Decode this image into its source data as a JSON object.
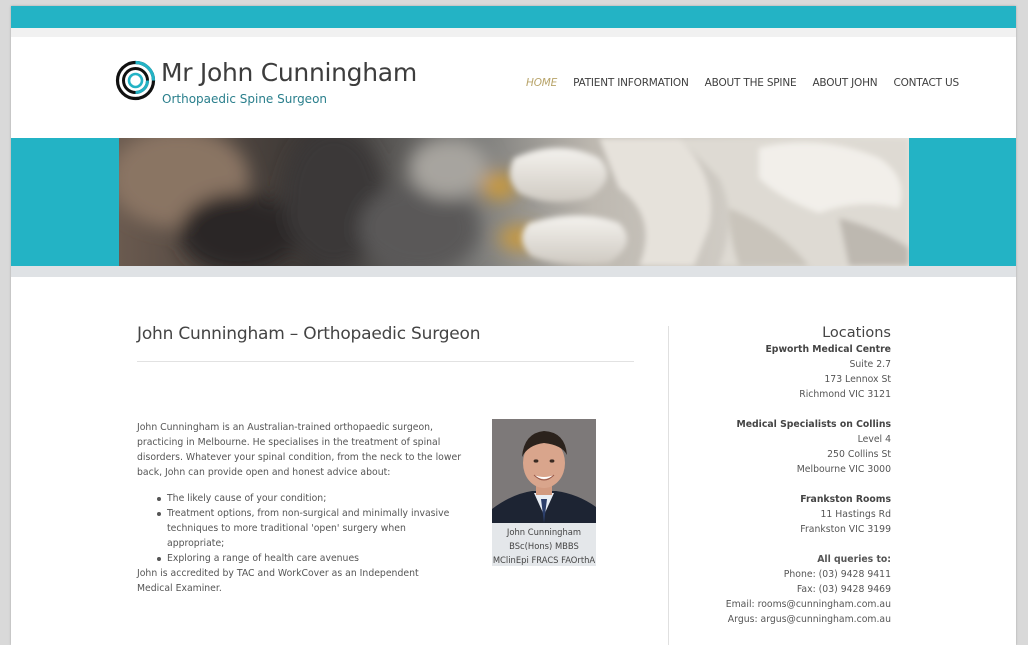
{
  "header": {
    "title": "Mr John Cunningham",
    "tagline": "Orthopaedic Spine Surgeon",
    "logo_icon": "concentric-circles-logo"
  },
  "nav": {
    "items": [
      {
        "label": "HOME",
        "active": true
      },
      {
        "label": "PATIENT INFORMATION",
        "active": false
      },
      {
        "label": "ABOUT THE SPINE",
        "active": false
      },
      {
        "label": "ABOUT JOHN",
        "active": false
      },
      {
        "label": "CONTACT US",
        "active": false
      }
    ]
  },
  "main": {
    "title": "John Cunningham – Orthopaedic Surgeon",
    "intro": "John Cunningham is an Australian-trained orthopaedic surgeon, practicing in Melbourne. He specialises in the treatment of spinal disorders. Whatever your spinal condition, from the neck to the lower back, John can provide open and honest advice about:",
    "bullets": [
      "The likely cause of your condition;",
      "Treatment options, from non-surgical and minimally invasive techniques to more traditional 'open' surgery when appropriate;",
      "Exploring a range of health care avenues"
    ],
    "accreditation": "John is accredited by TAC and WorkCover as an Independent Medical Examiner.",
    "photo_caption": {
      "name": "John Cunningham",
      "line2": "BSc(Hons) MBBS",
      "line3": "MClinEpi FRACS FAOrthA"
    }
  },
  "sidebar": {
    "heading": "Locations",
    "locations": [
      {
        "name": "Epworth Medical Centre",
        "lines": [
          "Suite 2.7",
          "173 Lennox St",
          "Richmond VIC 3121"
        ]
      },
      {
        "name": "Medical Specialists on Collins",
        "lines": [
          "Level 4",
          "250 Collins St",
          "Melbourne VIC 3000"
        ]
      },
      {
        "name": "Frankston Rooms",
        "lines": [
          "11 Hastings Rd",
          "Frankston VIC 3199"
        ]
      }
    ],
    "queries": {
      "heading": "All queries to:",
      "phone": "Phone: (03) 9428 9411",
      "fax": "Fax: (03) 9428 9469",
      "email": "Email: rooms@cunningham.com.au",
      "argus": "Argus: argus@cunningham.com.au"
    }
  },
  "colors": {
    "accent": "#23b3c5",
    "nav_active": "#b8a46a",
    "tagline": "#2a7f8c"
  }
}
